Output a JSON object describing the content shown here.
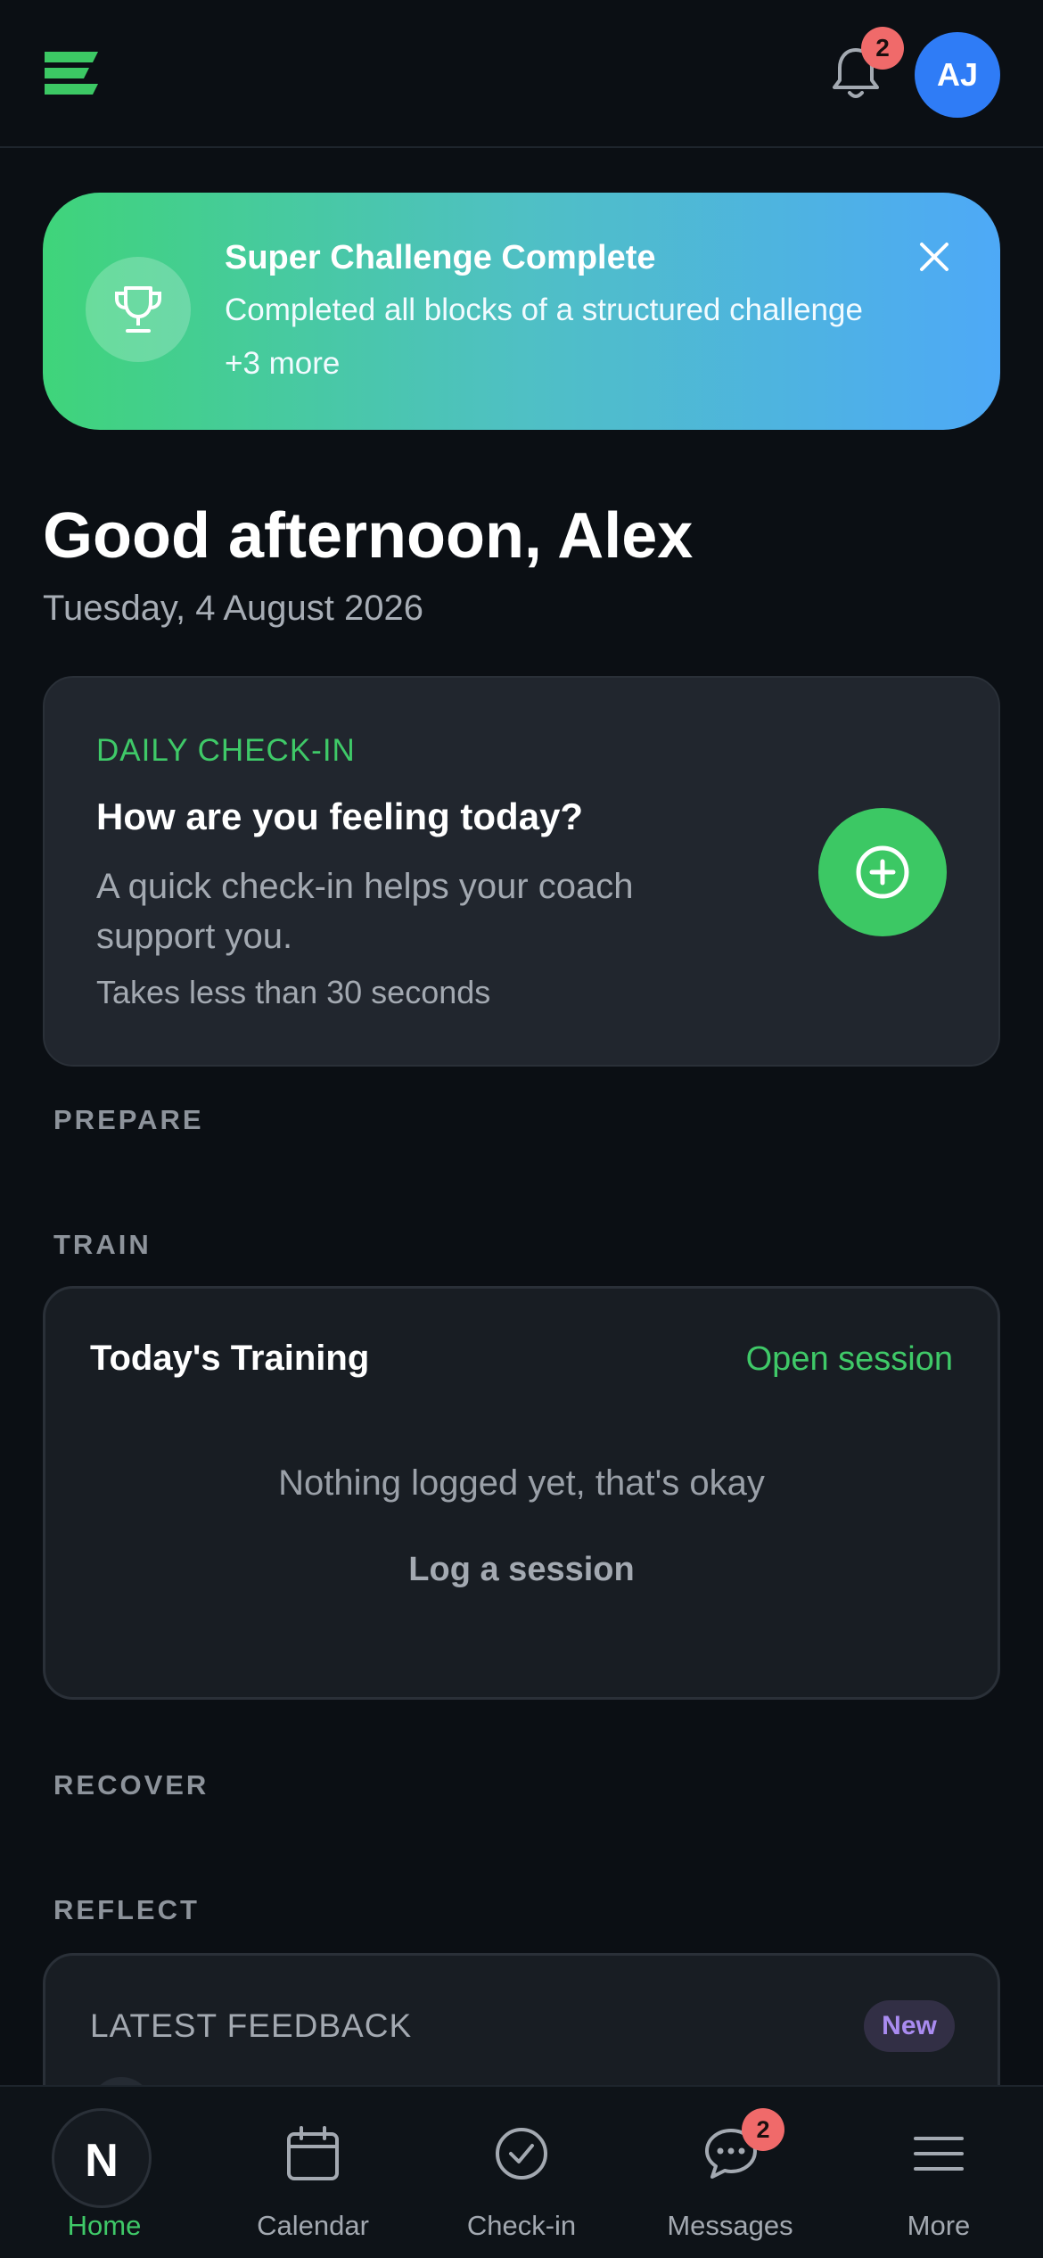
{
  "header": {
    "notifications_count": "2",
    "avatar_initials": "AJ"
  },
  "banner": {
    "title": "Super Challenge Complete",
    "description": "Completed all blocks of a structured challenge",
    "more": "+3 more"
  },
  "greeting": {
    "title": "Good afternoon, Alex",
    "date": "Tuesday, 4 August 2026"
  },
  "checkin": {
    "eyebrow": "DAILY CHECK-IN",
    "title": "How are you feeling today?",
    "description": "A quick check-in helps your coach support you.",
    "duration": "Takes less than 30 seconds"
  },
  "sections": {
    "prepare": "PREPARE",
    "train": "TRAIN",
    "recover": "RECOVER",
    "reflect": "REFLECT"
  },
  "training": {
    "title": "Today's Training",
    "open_label": "Open session",
    "empty_text": "Nothing logged yet, that's okay",
    "log_label": "Log a session"
  },
  "feedback": {
    "title": "LATEST FEEDBACK",
    "badge": "New"
  },
  "nav": {
    "home_logo": "N",
    "items": [
      {
        "label": "Home",
        "icon": "home-icon"
      },
      {
        "label": "Calendar",
        "icon": "calendar-icon"
      },
      {
        "label": "Check-in",
        "icon": "check-circle-icon"
      },
      {
        "label": "Messages",
        "icon": "chat-icon"
      },
      {
        "label": "More",
        "icon": "menu-icon"
      }
    ],
    "messages_count": "2"
  },
  "colors": {
    "accent": "#3fc968",
    "background": "#0b0f14",
    "card": "#21262e",
    "avatar": "#2f7cf6",
    "badge": "#f06a6a"
  }
}
